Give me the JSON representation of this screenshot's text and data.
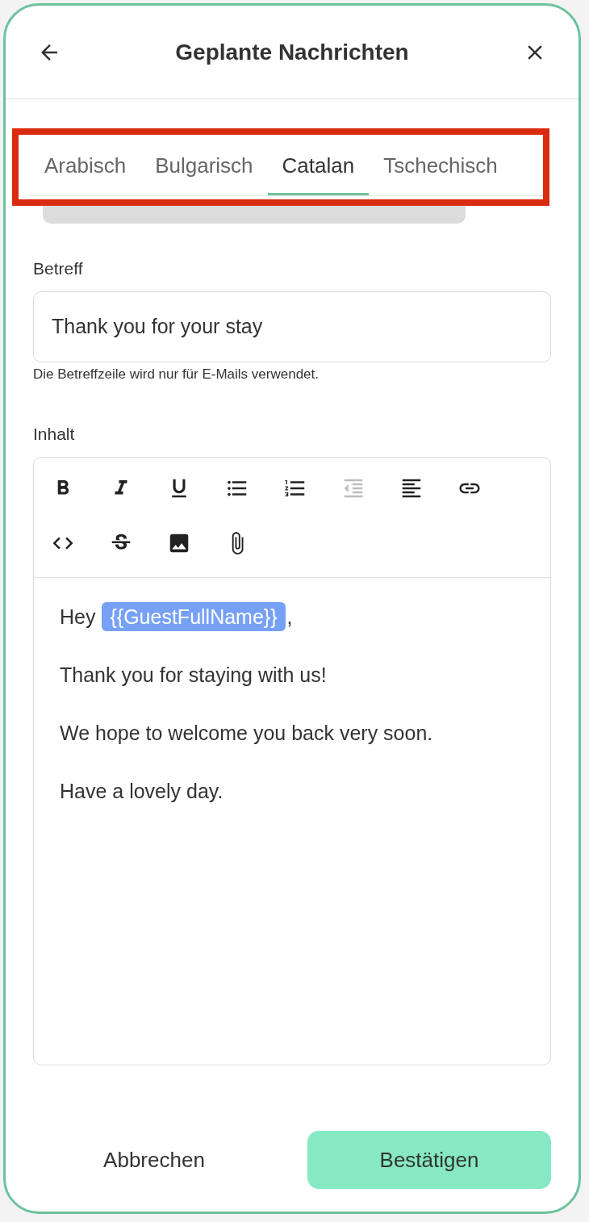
{
  "header": {
    "title": "Geplante Nachrichten"
  },
  "tabs": [
    {
      "label": "Arabisch",
      "selected": false
    },
    {
      "label": "Bulgarisch",
      "selected": false
    },
    {
      "label": "Catalan",
      "selected": true
    },
    {
      "label": "Tschechisch",
      "selected": false
    }
  ],
  "subject": {
    "label": "Betreff",
    "value": "Thank you for your stay",
    "hint": "Die Betreffzeile wird nur für E-Mails verwendet."
  },
  "content": {
    "label": "Inhalt",
    "toolbar": [
      {
        "kind": "bold",
        "disabled": false
      },
      {
        "kind": "italic",
        "disabled": false
      },
      {
        "kind": "underline",
        "disabled": false
      },
      {
        "kind": "bullets",
        "disabled": false
      },
      {
        "kind": "numbers",
        "disabled": false
      },
      {
        "kind": "outdent",
        "disabled": true
      },
      {
        "kind": "align",
        "disabled": false
      },
      {
        "kind": "link",
        "disabled": false
      },
      {
        "kind": "code",
        "disabled": false
      },
      {
        "kind": "strike",
        "disabled": false
      },
      {
        "kind": "image",
        "disabled": false
      },
      {
        "kind": "attach",
        "disabled": false
      }
    ],
    "paragraphs": [
      [
        {
          "kind": "text",
          "text": "Hey"
        },
        {
          "kind": "variable",
          "text": "{{GuestFullName}}"
        },
        {
          "kind": "text",
          "text": ","
        }
      ],
      [
        {
          "kind": "text",
          "text": "Thank you for staying with us!"
        }
      ],
      [
        {
          "kind": "text",
          "text": "We hope to welcome you back very soon."
        }
      ],
      [
        {
          "kind": "text",
          "text": "Have a lovely day."
        }
      ]
    ]
  },
  "footer": {
    "cancel": "Abbrechen",
    "confirm": "Bestätigen"
  }
}
